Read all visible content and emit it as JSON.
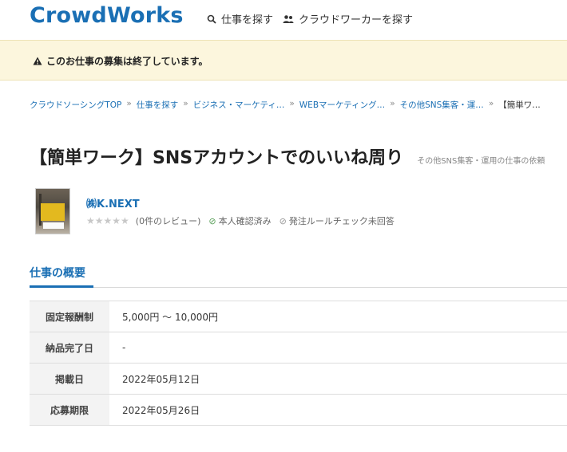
{
  "header": {
    "logo": "CrowdWorks",
    "nav_find_jobs": "仕事を探す",
    "nav_find_workers": "クラウドワーカーを探す"
  },
  "alert": {
    "text": "このお仕事の募集は終了しています。"
  },
  "breadcrumb": [
    "クラウドソーシングTOP",
    "仕事を探す",
    "ビジネス・マーケティ…",
    "WEBマーケティング…",
    "その他SNS集客・運…",
    "【簡単ワ…"
  ],
  "job": {
    "title": "【簡単ワーク】SNSアカウントでのいいね周り",
    "category": "その他SNS集客・運用の仕事の依頼"
  },
  "client": {
    "name": "㈱K.NEXT",
    "stars": "★★★★★",
    "reviews": "(0件のレビュー)",
    "identity_verified": "本人確認済み",
    "rule_check": "発注ルールチェック未回答",
    "colors": {
      "verified": "#5aa05a",
      "unverified": "#999999"
    }
  },
  "overview": {
    "heading": "仕事の概要",
    "rows": [
      {
        "label": "固定報酬制",
        "value": "5,000円 〜 10,000円"
      },
      {
        "label": "納品完了日",
        "value": "-"
      },
      {
        "label": "掲載日",
        "value": "2022年05月12日"
      },
      {
        "label": "応募期限",
        "value": "2022年05月26日"
      }
    ]
  },
  "colors": {
    "brand": "#1a6fb4",
    "alert_bg": "#fcf6dd"
  },
  "icons": {
    "search": "search-icon",
    "people": "people-icon",
    "warning": "warning-icon",
    "check": "check-circle-icon",
    "no": "no-circle-icon"
  }
}
